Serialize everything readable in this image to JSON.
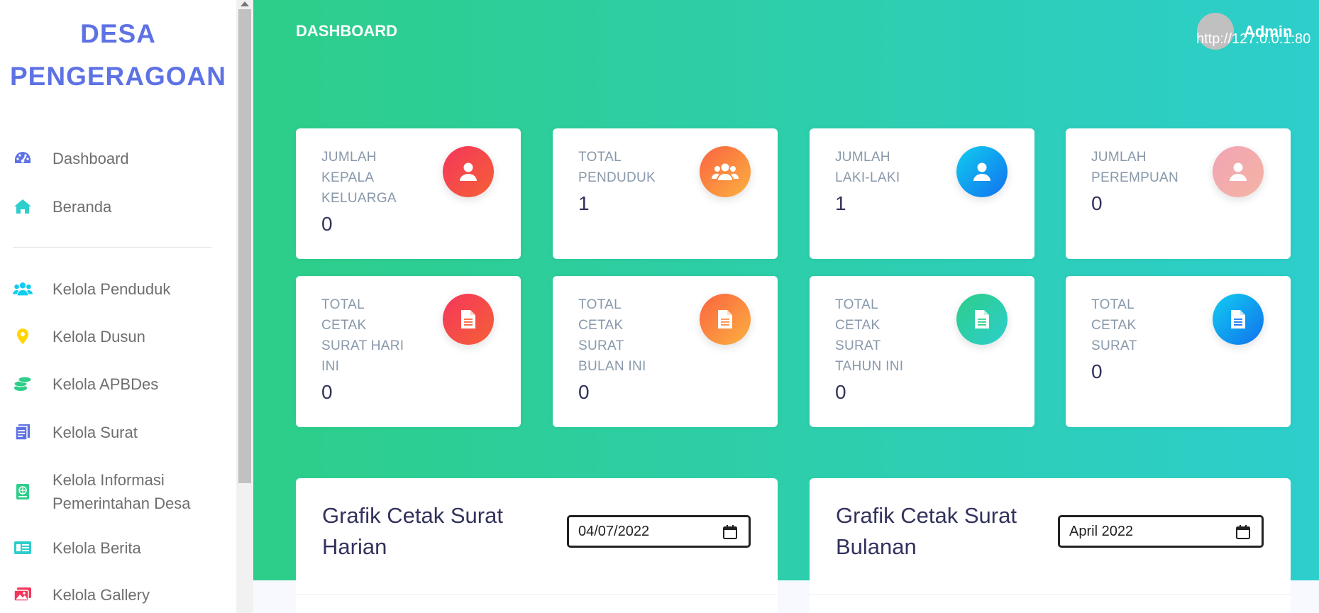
{
  "brand": {
    "line1": "DESA",
    "line2": "PENGERAGOAN"
  },
  "sidebar": {
    "items": [
      {
        "label": "Dashboard",
        "icon": "speedometer-icon",
        "color": "#5e72e4"
      },
      {
        "label": "Beranda",
        "icon": "home-icon",
        "color": "#2dcecc"
      },
      {
        "label": "Kelola Penduduk",
        "icon": "users-icon",
        "color": "#11cdef"
      },
      {
        "label": "Kelola Dusun",
        "icon": "map-pin-icon",
        "color": "#ffd600"
      },
      {
        "label": "Kelola APBDes",
        "icon": "coins-icon",
        "color": "#2dce89"
      },
      {
        "label": "Kelola Surat",
        "icon": "document-icon",
        "color": "#5e72e4"
      },
      {
        "label": "Kelola Informasi Pemerintahan Desa",
        "label_l1": "Kelola Informasi",
        "label_l2": "Pemerintahan Desa",
        "icon": "globe-book-icon",
        "color": "#2dce89"
      },
      {
        "label": "Kelola Berita",
        "icon": "newspaper-icon",
        "color": "#2dcecc"
      },
      {
        "label": "Kelola Gallery",
        "icon": "images-icon",
        "color": "#f5365c"
      }
    ]
  },
  "header": {
    "title": "DASHBOARD",
    "user": "Admin",
    "broken_image_text": "http://127.0.0.1:80"
  },
  "stats": [
    {
      "title_lines": [
        "JUMLAH",
        "KEPALA",
        "KELUARGA"
      ],
      "value": "0",
      "icon": "user-icon",
      "color": "red"
    },
    {
      "title_lines": [
        "TOTAL",
        "PENDUDUK"
      ],
      "value": "1",
      "icon": "users-icon",
      "color": "orange"
    },
    {
      "title_lines": [
        "JUMLAH",
        "LAKI-LAKI"
      ],
      "value": "1",
      "icon": "user-icon",
      "color": "blue"
    },
    {
      "title_lines": [
        "JUMLAH",
        "PEREMPUAN"
      ],
      "value": "0",
      "icon": "user-icon",
      "color": "pink"
    },
    {
      "title_lines": [
        "TOTAL",
        "CETAK",
        "SURAT HARI",
        "INI"
      ],
      "value": "0",
      "icon": "file-icon",
      "color": "red"
    },
    {
      "title_lines": [
        "TOTAL",
        "CETAK",
        "SURAT",
        "BULAN INI"
      ],
      "value": "0",
      "icon": "file-icon",
      "color": "orange"
    },
    {
      "title_lines": [
        "TOTAL",
        "CETAK",
        "SURAT",
        "TAHUN INI"
      ],
      "value": "0",
      "icon": "file-icon",
      "color": "green"
    },
    {
      "title_lines": [
        "TOTAL",
        "CETAK",
        "SURAT"
      ],
      "value": "0",
      "icon": "file-icon",
      "color": "blue"
    }
  ],
  "charts": [
    {
      "title_l1": "Grafik Cetak Surat",
      "title_l2": "Harian",
      "date_value": "04/07/2022"
    },
    {
      "title_l1": "Grafik Cetak Surat",
      "title_l2": "Bulanan",
      "date_value": "April 2022"
    }
  ]
}
